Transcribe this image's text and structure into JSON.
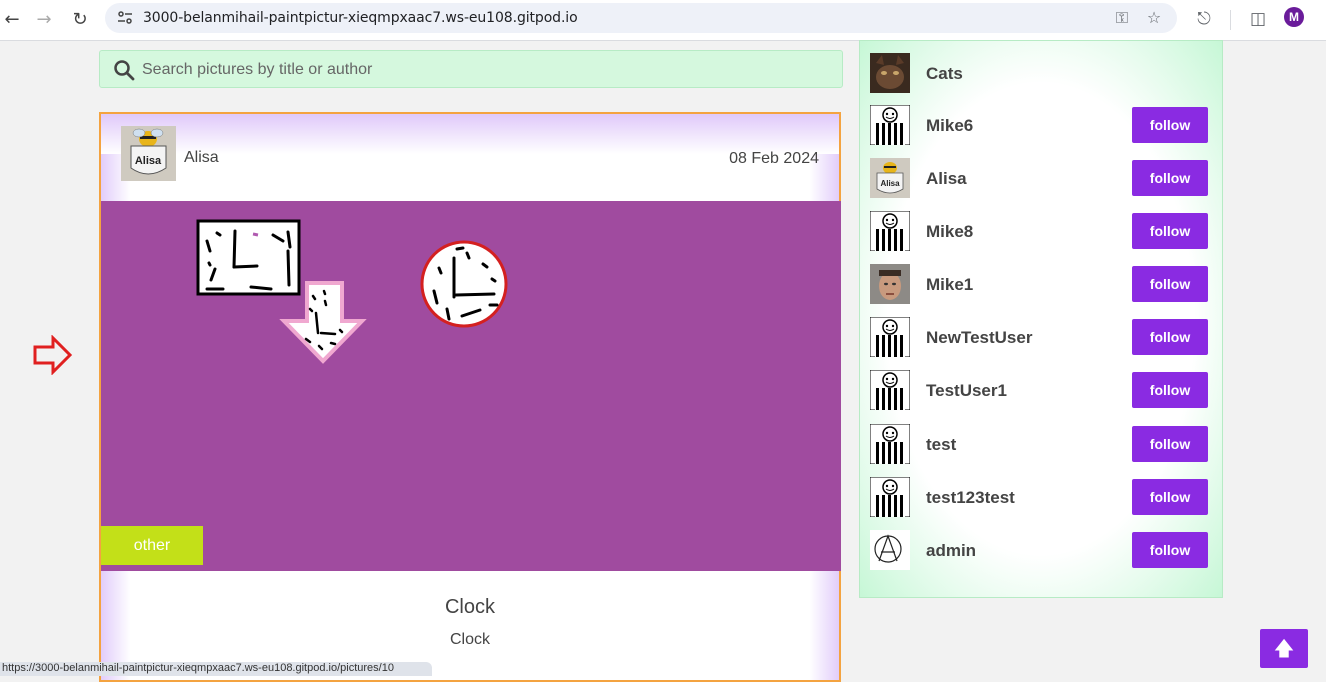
{
  "browser": {
    "url": "3000-belanmihail-paintpictur-xieqmpxaac7.ws-eu108.gitpod.io",
    "profile_initial": "M",
    "status_url": "https://3000-belanmihail-paintpictur-xieqmpxaac7.ws-eu108.gitpod.io/pictures/10"
  },
  "search": {
    "placeholder": "Search pictures by title or author"
  },
  "post": {
    "author": "Alisa",
    "date": "08 Feb 2024",
    "category": "other",
    "title": "Clock",
    "description": "Clock",
    "background_color": "#a04b9f"
  },
  "users": [
    {
      "name": "Cats",
      "avatar": "cat-photo",
      "show_follow": false
    },
    {
      "name": "Mike6",
      "avatar": "striped-figure",
      "show_follow": true
    },
    {
      "name": "Alisa",
      "avatar": "alisa-badge",
      "show_follow": true
    },
    {
      "name": "Mike8",
      "avatar": "striped-figure",
      "show_follow": true
    },
    {
      "name": "Mike1",
      "avatar": "face-photo",
      "show_follow": true
    },
    {
      "name": "NewTestUser",
      "avatar": "striped-figure",
      "show_follow": true
    },
    {
      "name": "TestUser1",
      "avatar": "striped-figure",
      "show_follow": true
    },
    {
      "name": "test",
      "avatar": "striped-figure",
      "show_follow": true
    },
    {
      "name": "test123test",
      "avatar": "striped-figure",
      "show_follow": true
    },
    {
      "name": "admin",
      "avatar": "anarchy-symbol",
      "show_follow": true
    }
  ],
  "follow_label": "follow",
  "colors": {
    "accent": "#8a2be2",
    "search_bg": "#d5f8de",
    "card_border": "#f4a340",
    "category_bg": "#c3e018"
  },
  "scroll_top_icon": "arrow-up-icon"
}
